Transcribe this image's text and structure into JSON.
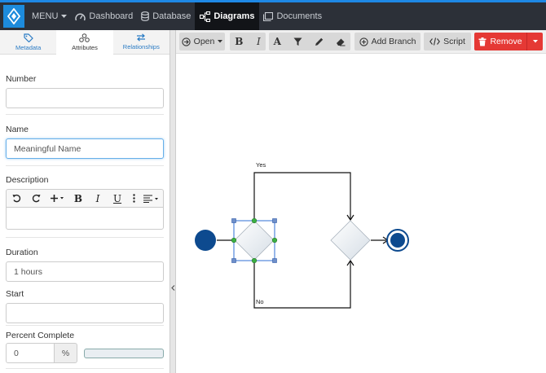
{
  "nav": {
    "menu_label": "MENU",
    "items": [
      {
        "label": "Dashboard",
        "icon": "dashboard-icon"
      },
      {
        "label": "Database",
        "icon": "database-icon"
      },
      {
        "label": "Diagrams",
        "icon": "diagram-icon",
        "active": true
      },
      {
        "label": "Documents",
        "icon": "document-icon"
      }
    ]
  },
  "left_panel": {
    "tabs": [
      {
        "label": "Metadata",
        "icon": "tag-icon"
      },
      {
        "label": "Attributes",
        "icon": "attributes-icon",
        "active": true
      },
      {
        "label": "Relationships",
        "icon": "swap-icon"
      }
    ],
    "fields": {
      "number": {
        "label": "Number",
        "value": ""
      },
      "name": {
        "label": "Name",
        "value": "Meaningful Name"
      },
      "description": {
        "label": "Description",
        "value": ""
      },
      "duration": {
        "label": "Duration",
        "value": "1 hours"
      },
      "start": {
        "label": "Start",
        "value": ""
      },
      "percent": {
        "label": "Percent Complete",
        "value": "0",
        "unit": "%",
        "progress": 0
      }
    }
  },
  "toolbar": {
    "open_label": "Open",
    "add_branch_label": "Add Branch",
    "script_label": "Script",
    "remove_label": "Remove"
  },
  "diagram": {
    "yes_label": "Yes",
    "no_label": "No"
  },
  "colors": {
    "accent": "#1e88e5",
    "nav_bg": "#2c3038",
    "danger": "#e53935",
    "node_blue": "#0d4a8f"
  }
}
